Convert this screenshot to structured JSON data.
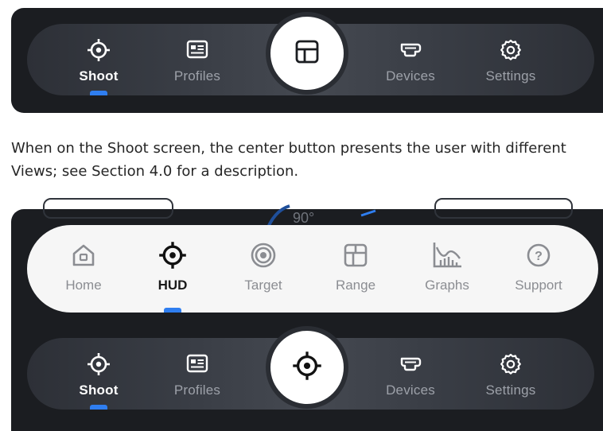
{
  "top_nav": {
    "items": [
      {
        "label": "Shoot",
        "icon": "crosshair-icon",
        "active": true
      },
      {
        "label": "Profiles",
        "icon": "profile-card-icon",
        "active": false
      },
      {
        "label": "Devices",
        "icon": "device-icon",
        "active": false
      },
      {
        "label": "Settings",
        "icon": "gear-icon",
        "active": false
      }
    ],
    "center_icon": "grid-views-icon"
  },
  "caption": {
    "text": "When on the Shoot screen, the center button presents the user with different Views; see Section 4.0 for a description."
  },
  "background_hint": {
    "degrees": "90°"
  },
  "views_menu": {
    "items": [
      {
        "label": "Home",
        "icon": "home-icon",
        "active": false
      },
      {
        "label": "HUD",
        "icon": "crosshair-icon",
        "active": true
      },
      {
        "label": "Target",
        "icon": "target-icon",
        "active": false
      },
      {
        "label": "Range",
        "icon": "range-grid-icon",
        "active": false
      },
      {
        "label": "Graphs",
        "icon": "graphs-icon",
        "active": false
      },
      {
        "label": "Support",
        "icon": "support-icon",
        "active": false
      }
    ]
  },
  "bottom_nav": {
    "items": [
      {
        "label": "Shoot",
        "icon": "crosshair-icon",
        "active": true
      },
      {
        "label": "Profiles",
        "icon": "profile-card-icon",
        "active": false
      },
      {
        "label": "Devices",
        "icon": "device-icon",
        "active": false
      },
      {
        "label": "Settings",
        "icon": "gear-icon",
        "active": false
      }
    ],
    "center_icon": "crosshair-icon"
  },
  "colors": {
    "panel": "#1b1d21",
    "accent": "#2f7ef0",
    "active_label": "#ffffff",
    "inactive_label": "#9da1a9"
  }
}
